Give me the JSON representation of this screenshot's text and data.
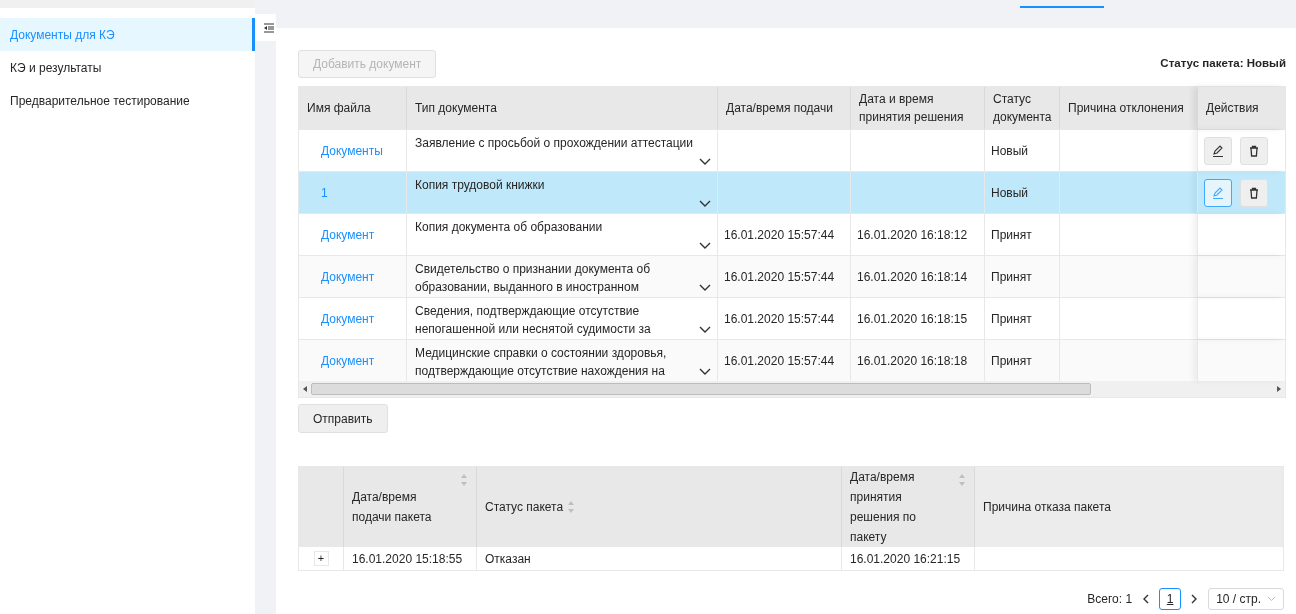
{
  "sidebar": {
    "items": [
      {
        "label": "Документы для КЭ",
        "selected": true
      },
      {
        "label": "КЭ и результаты",
        "selected": false
      },
      {
        "label": "Предварительное тестирование",
        "selected": false
      }
    ]
  },
  "toolbar": {
    "add_button": {
      "label": "Добавить документ",
      "disabled": true
    },
    "package_status": "Статус пакета: Новый"
  },
  "documents": {
    "columns": [
      "Имя файла",
      "Тип документа",
      "Дата/время подачи",
      "Дата и время принятия решения",
      "Статус документа",
      "Причина отклонения",
      "Действия"
    ],
    "rows": [
      {
        "file": "Документы",
        "type": "Заявление с просьбой о прохождении аттестации",
        "submitted": "",
        "decided": "",
        "status": "Новый",
        "reason": "",
        "selected": false,
        "actions": [
          {
            "kind": "edit",
            "focused": false
          },
          {
            "kind": "delete",
            "focused": false
          }
        ]
      },
      {
        "file": "1",
        "type": "Копия трудовой книжки",
        "submitted": "",
        "decided": "",
        "status": "Новый",
        "reason": "",
        "selected": true,
        "actions": [
          {
            "kind": "edit",
            "focused": true
          },
          {
            "kind": "delete",
            "focused": false
          }
        ]
      },
      {
        "file": "Документ",
        "type": "Копия документа об образовании",
        "submitted": "16.01.2020 15:57:44",
        "decided": "16.01.2020 16:18:12",
        "status": "Принят",
        "reason": "",
        "selected": false,
        "actions": []
      },
      {
        "file": "Документ",
        "type": "Свидетельство о признании документа об образовании, выданного в иностранном",
        "submitted": "16.01.2020 15:57:44",
        "decided": "16.01.2020 16:18:14",
        "status": "Принят",
        "reason": "",
        "selected": false,
        "actions": []
      },
      {
        "file": "Документ",
        "type": "Сведения, подтверждающие отсутствие непогашенной или неснятой судимости за",
        "submitted": "16.01.2020 15:57:44",
        "decided": "16.01.2020 16:18:15",
        "status": "Принят",
        "reason": "",
        "selected": false,
        "actions": []
      },
      {
        "file": "Документ",
        "type": "Медицинские справки о состоянии здоровья, подтверждающие отсутствие нахождения на",
        "submitted": "16.01.2020 15:57:44",
        "decided": "16.01.2020 16:18:18",
        "status": "Принят",
        "reason": "",
        "selected": false,
        "actions": []
      }
    ]
  },
  "send_button": "Отправить",
  "packages": {
    "columns": [
      {
        "label": "Дата/время подачи пакета",
        "sortable": true
      },
      {
        "label": "Статус пакета",
        "sortable": true
      },
      {
        "label": "Дата/время принятия решения по пакету",
        "sortable": true
      },
      {
        "label": "Причина отказа пакета",
        "sortable": false
      }
    ],
    "rows": [
      {
        "expand": "+",
        "submitted": "16.01.2020 15:18:55",
        "status": "Отказан",
        "decided": "16.01.2020 16:21:15",
        "reason": ""
      }
    ]
  },
  "pagination": {
    "total": "Всего: 1",
    "pages": [
      {
        "label": "1",
        "selected": true
      }
    ],
    "page_size": "10 / стр."
  }
}
